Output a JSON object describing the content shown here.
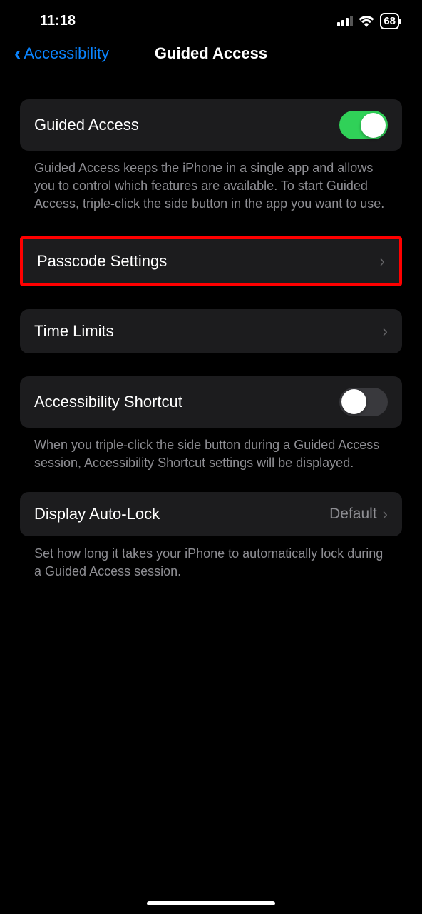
{
  "status": {
    "time": "11:18",
    "battery": "68"
  },
  "nav": {
    "back_label": "Accessibility",
    "title": "Guided Access"
  },
  "sections": {
    "guided_access": {
      "label": "Guided Access",
      "toggle": true,
      "footer": "Guided Access keeps the iPhone in a single app and allows you to control which features are available. To start Guided Access, triple-click the side button in the app you want to use."
    },
    "passcode": {
      "label": "Passcode Settings"
    },
    "time_limits": {
      "label": "Time Limits"
    },
    "accessibility_shortcut": {
      "label": "Accessibility Shortcut",
      "toggle": false,
      "footer": "When you triple-click the side button during a Guided Access session, Accessibility Shortcut settings will be displayed."
    },
    "display_autolock": {
      "label": "Display Auto-Lock",
      "value": "Default",
      "footer": "Set how long it takes your iPhone to automatically lock during a Guided Access session."
    }
  }
}
